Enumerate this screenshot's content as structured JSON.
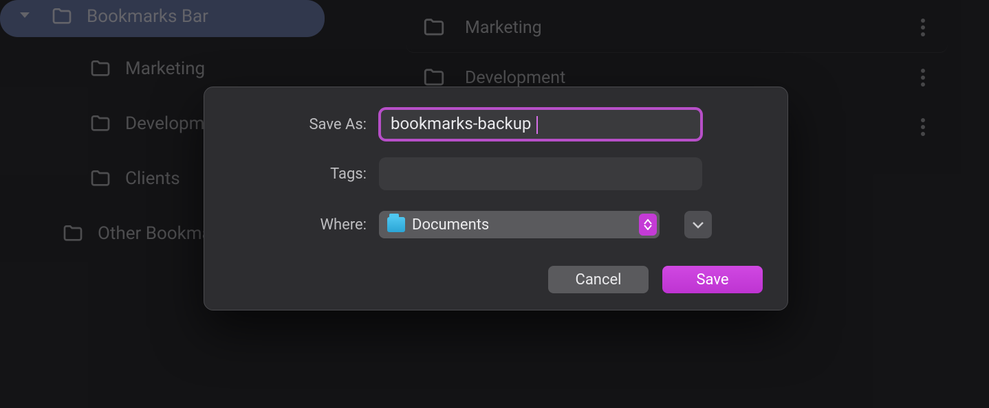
{
  "sidebar": {
    "selected": {
      "label": "Bookmarks Bar"
    },
    "children": [
      {
        "label": "Marketing"
      },
      {
        "label": "Development"
      },
      {
        "label": "Clients"
      }
    ],
    "other": {
      "label": "Other Bookmarks"
    }
  },
  "list": {
    "rows": [
      {
        "title": "Marketing"
      },
      {
        "title": "Development"
      }
    ]
  },
  "dialog": {
    "save_as_label": "Save As:",
    "save_as_value": "bookmarks-backup",
    "tags_label": "Tags:",
    "tags_value": "",
    "where_label": "Where:",
    "where_value": "Documents",
    "cancel_label": "Cancel",
    "save_label": "Save"
  },
  "colors": {
    "accent": "#c43bd6",
    "focus_ring": "#b74fc8"
  }
}
